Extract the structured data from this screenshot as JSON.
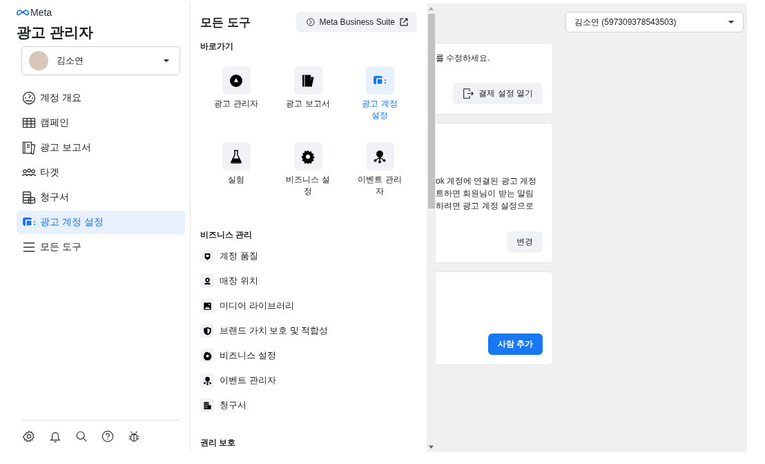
{
  "brand": {
    "logo_text": "Meta",
    "title": "광고 관리자"
  },
  "account_selector": {
    "name": "김소연"
  },
  "nav": [
    {
      "label": "계정 개요",
      "selected": false
    },
    {
      "label": "캠페인",
      "selected": false
    },
    {
      "label": "광고 보고서",
      "selected": false
    },
    {
      "label": "타겟",
      "selected": false
    },
    {
      "label": "청구서",
      "selected": false
    },
    {
      "label": "광고 계정 설정",
      "selected": true
    },
    {
      "label": "모든 도구",
      "selected": false
    }
  ],
  "tools_panel": {
    "title": "모든 도구",
    "suite_button": "Meta Business Suite",
    "shortcuts": {
      "heading": "바로가기",
      "tiles": [
        {
          "label": "광고 관리자",
          "selected": false
        },
        {
          "label": "광고 보고서",
          "selected": false
        },
        {
          "label": "광고 계정 설정",
          "selected": true
        },
        {
          "label": "실험",
          "selected": false
        },
        {
          "label": "비즈니스 설정",
          "selected": false
        },
        {
          "label": "이벤트 관리자",
          "selected": false
        }
      ]
    },
    "business": {
      "heading": "비즈니스 관리",
      "items": [
        "계정 품질",
        "매장 위치",
        "미디어 라이브러리",
        "브랜드 가치 보호 및 적합성",
        "비즈니스 설정",
        "이벤트 관리자",
        "청구서"
      ]
    },
    "rights": {
      "heading": "권리 보호"
    }
  },
  "main": {
    "account_dropdown": "김소연 (597309378543503)",
    "cards": [
      {
        "lines": [
          "를 수정하세요."
        ],
        "button": {
          "label": "결제 설정 열기",
          "kind": "secondary"
        }
      },
      {
        "lines": [
          "ok 계정에 연결된 광고 계정",
          "트하면 회원님이 받는 알림",
          "하려면 광고 계정 설정으로"
        ],
        "button": {
          "label": "변경",
          "kind": "secondary"
        }
      },
      {
        "button": {
          "label": "사람 추가",
          "kind": "primary"
        }
      }
    ]
  }
}
